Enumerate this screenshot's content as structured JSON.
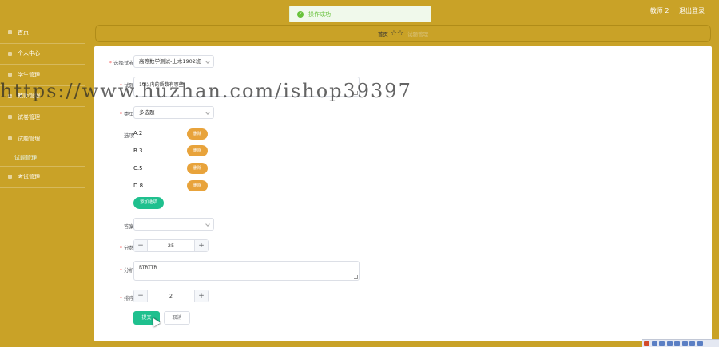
{
  "header": {
    "user": "教师 2",
    "logout": "退出登录"
  },
  "toast": {
    "text": "操作成功",
    "icon": "success-check-icon",
    "color": "#67c23a"
  },
  "sidebar": {
    "items": [
      {
        "label": "首页"
      },
      {
        "label": "个人中心"
      },
      {
        "label": "学生管理"
      },
      {
        "label": "教师管理"
      },
      {
        "label": "试卷管理"
      },
      {
        "label": "试题管理"
      },
      {
        "label": "考试管理"
      }
    ],
    "submenu": {
      "label": "试题管理"
    }
  },
  "breadcrumb": {
    "home": "首页",
    "current": "试题管理"
  },
  "form": {
    "paper": {
      "label": "选择试卷",
      "value": "高等数学测试-土木1902班"
    },
    "question": {
      "label": "试题",
      "value": "10以内的质数有哪些"
    },
    "type": {
      "label": "类型",
      "value": "多选题"
    },
    "options": {
      "label": "选项",
      "items": [
        "A.2",
        "B.3",
        "C.5",
        "D.8"
      ],
      "delete_label": "删除",
      "add_label": "添加选项"
    },
    "answer": {
      "label": "答案",
      "value": ""
    },
    "score": {
      "label": "分数",
      "value": "25"
    },
    "analysis": {
      "label": "分析",
      "value": "RTRTTR"
    },
    "order": {
      "label": "排序",
      "value": "2"
    },
    "submit_label": "提交",
    "cancel_label": "取消"
  },
  "watermark": "https://www.huzhan.com/ishop39397",
  "colors": {
    "theme": "#c9a227",
    "accent": "#1fc08e",
    "delete": "#e8a33b"
  }
}
